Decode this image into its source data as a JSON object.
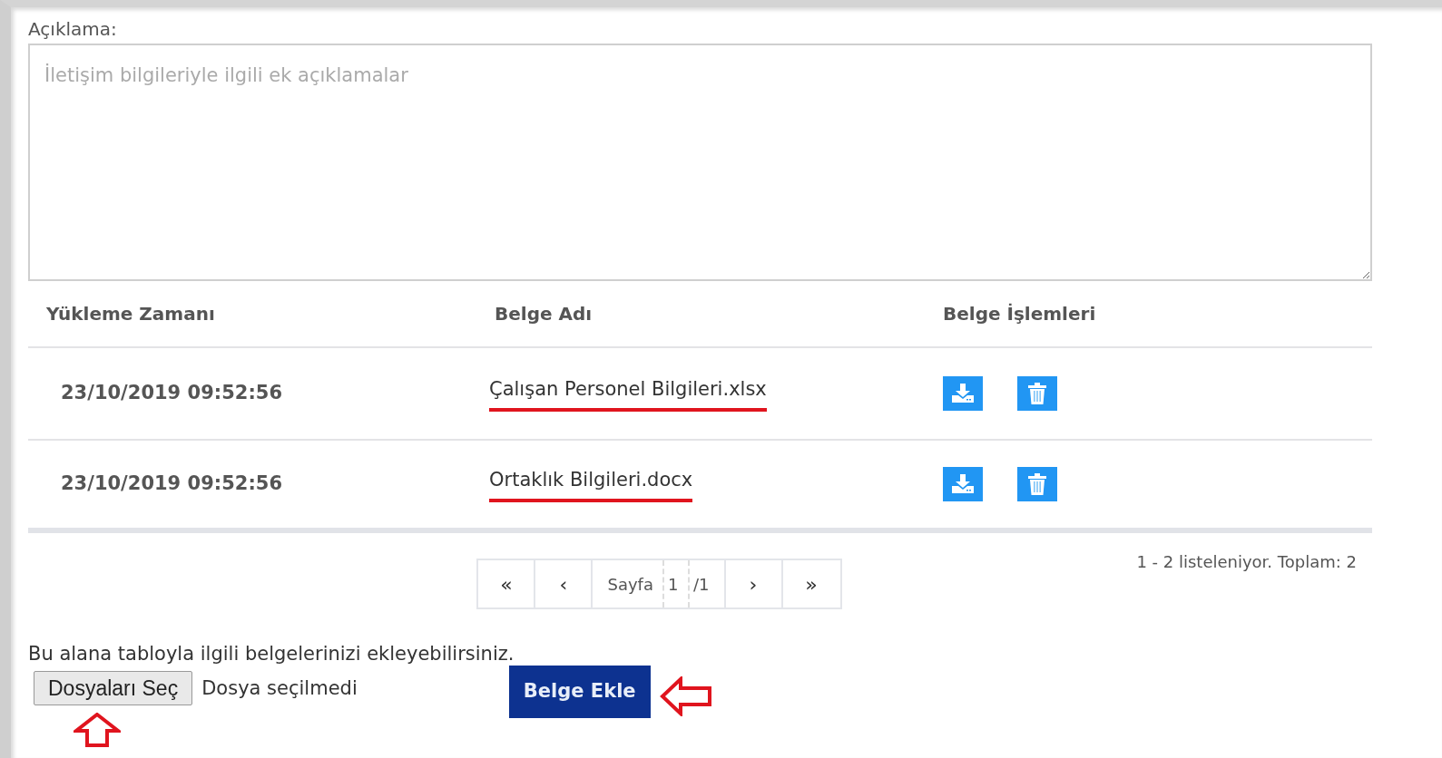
{
  "description": {
    "label": "Açıklama:",
    "placeholder": "İletişim bilgileriyle ilgili ek açıklamalar"
  },
  "table": {
    "columns": [
      "Yükleme Zamanı",
      "Belge Adı",
      "Belge İşlemleri"
    ],
    "rows": [
      {
        "uploaded": "23/10/2019 09:52:56",
        "document": "Çalışan Personel Bilgileri.xlsx",
        "highlighted": true
      },
      {
        "uploaded": "23/10/2019 09:52:56",
        "document": "Ortaklık Bilgileri.docx",
        "highlighted": true
      }
    ]
  },
  "pager": {
    "first": "«",
    "prev": "‹",
    "page_label": "Sayfa",
    "page": "1",
    "total": "/1",
    "next": "›",
    "last": "»"
  },
  "summary": "1 - 2 listeleniyor. Toplam: 2",
  "upload": {
    "hint": "Bu alana tabloyla ilgili belgelerinizi ekleyebilirsiniz.",
    "choose_button": "Dosyaları Seç",
    "file_status": "Dosya seçilmedi",
    "add_button": "Belge Ekle"
  }
}
